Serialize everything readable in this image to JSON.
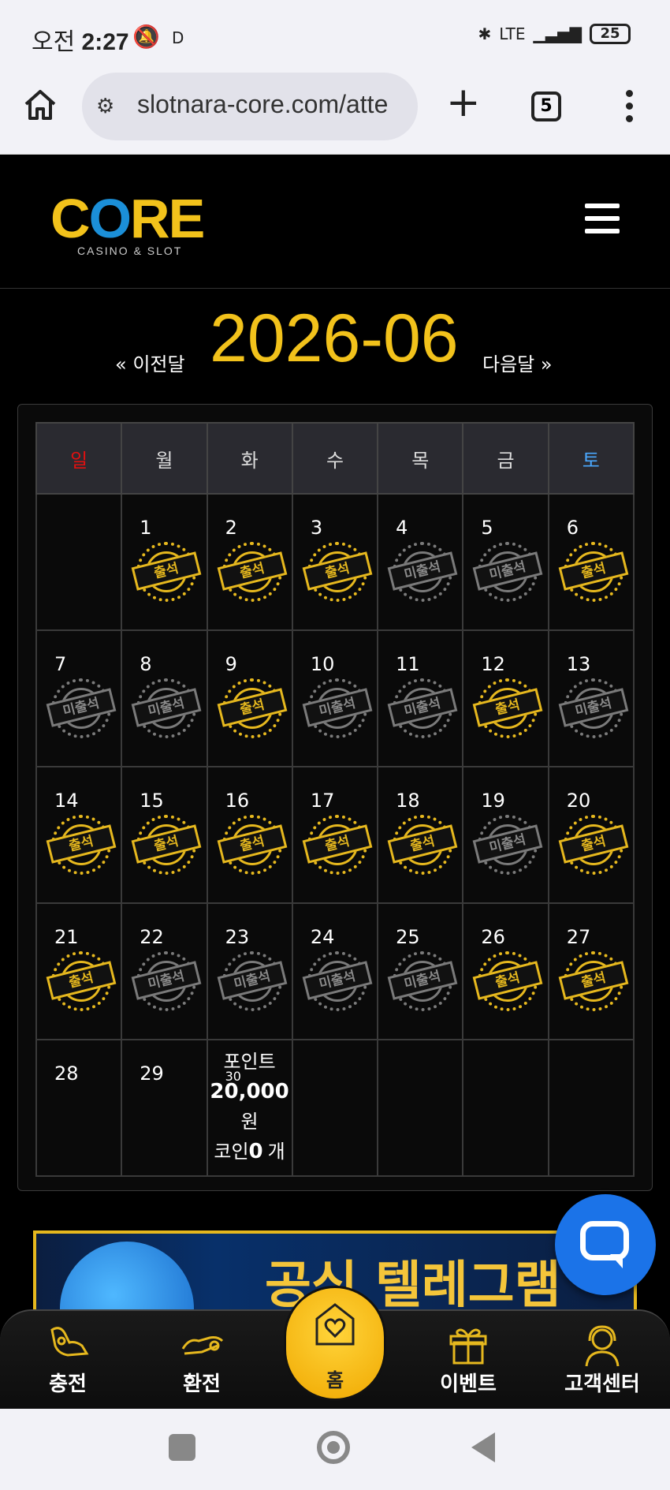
{
  "status_bar": {
    "time_prefix": "오전",
    "time": "2:27",
    "indicator": "D",
    "network": "LTE",
    "battery": "25"
  },
  "browser": {
    "url": "slotnara-core.com/atte",
    "tab_count": "5"
  },
  "site": {
    "logo_text_1": "C",
    "logo_text_o": "O",
    "logo_text_2": "RE",
    "logo_sub": "CASINO & SLOT"
  },
  "month_nav": {
    "prev_label": "« 이전달",
    "title": "2026-06",
    "next_label": "다음달 »"
  },
  "calendar": {
    "weekdays": [
      "일",
      "월",
      "화",
      "수",
      "목",
      "금",
      "토"
    ],
    "stamp_attended": "출석",
    "stamp_absent": "미출석",
    "weeks": [
      [
        null,
        {
          "day": "1",
          "status": "attended"
        },
        {
          "day": "2",
          "status": "attended"
        },
        {
          "day": "3",
          "status": "attended"
        },
        {
          "day": "4",
          "status": "absent"
        },
        {
          "day": "5",
          "status": "absent"
        },
        {
          "day": "6",
          "status": "attended"
        }
      ],
      [
        {
          "day": "7",
          "status": "absent"
        },
        {
          "day": "8",
          "status": "absent"
        },
        {
          "day": "9",
          "status": "attended"
        },
        {
          "day": "10",
          "status": "absent"
        },
        {
          "day": "11",
          "status": "absent"
        },
        {
          "day": "12",
          "status": "attended"
        },
        {
          "day": "13",
          "status": "absent"
        }
      ],
      [
        {
          "day": "14",
          "status": "attended"
        },
        {
          "day": "15",
          "status": "attended"
        },
        {
          "day": "16",
          "status": "attended"
        },
        {
          "day": "17",
          "status": "attended"
        },
        {
          "day": "18",
          "status": "attended"
        },
        {
          "day": "19",
          "status": "absent"
        },
        {
          "day": "20",
          "status": "attended"
        }
      ],
      [
        {
          "day": "21",
          "status": "attended"
        },
        {
          "day": "22",
          "status": "absent"
        },
        {
          "day": "23",
          "status": "absent"
        },
        {
          "day": "24",
          "status": "absent"
        },
        {
          "day": "25",
          "status": "absent"
        },
        {
          "day": "26",
          "status": "attended"
        },
        {
          "day": "27",
          "status": "attended"
        }
      ],
      [
        {
          "day": "28",
          "status": "none"
        },
        {
          "day": "29",
          "status": "none"
        },
        {
          "day": "30",
          "status": "points"
        },
        null,
        null,
        null,
        null
      ]
    ],
    "points_label": "포인트",
    "points_value": "20,000",
    "points_unit": "원",
    "coin_label": "코인",
    "coin_value": "0",
    "coin_unit": "개"
  },
  "banner": {
    "text": "공식 텔레그램"
  },
  "bottom_nav": {
    "deposit": "충전",
    "withdraw": "환전",
    "home": "홈",
    "event": "이벤트",
    "support": "고객센터"
  },
  "colors": {
    "gold": "#e6b81e",
    "sunday": "#e01010",
    "saturday": "#4aa8ff",
    "chat": "#1b73e8"
  }
}
